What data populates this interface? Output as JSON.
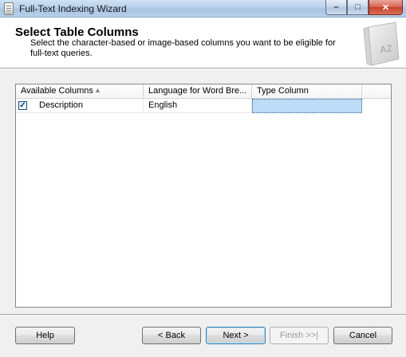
{
  "window": {
    "title": "Full-Text Indexing Wizard",
    "controls": {
      "minimize": "–",
      "maximize": "□",
      "close": "✕"
    }
  },
  "header": {
    "title": "Select Table Columns",
    "description": "Select the character-based or image-based columns you want to be eligible for full-text queries.",
    "icon": "book-az-icon",
    "icon_text": "AZ"
  },
  "grid": {
    "columns": [
      "Available Columns",
      "Language for Word Bre...",
      "Type Column",
      ""
    ],
    "rows": [
      {
        "checked": true,
        "check_glyph": "✓",
        "column": "Description",
        "language": "English",
        "type_column": ""
      }
    ]
  },
  "buttons": {
    "help": "Help",
    "back": "< Back",
    "next": "Next >",
    "finish": "Finish >>|",
    "cancel": "Cancel"
  },
  "colors": {
    "title_bar": "#b9d1ea",
    "selection": "#bedcf7",
    "close_button": "#c7402a"
  }
}
